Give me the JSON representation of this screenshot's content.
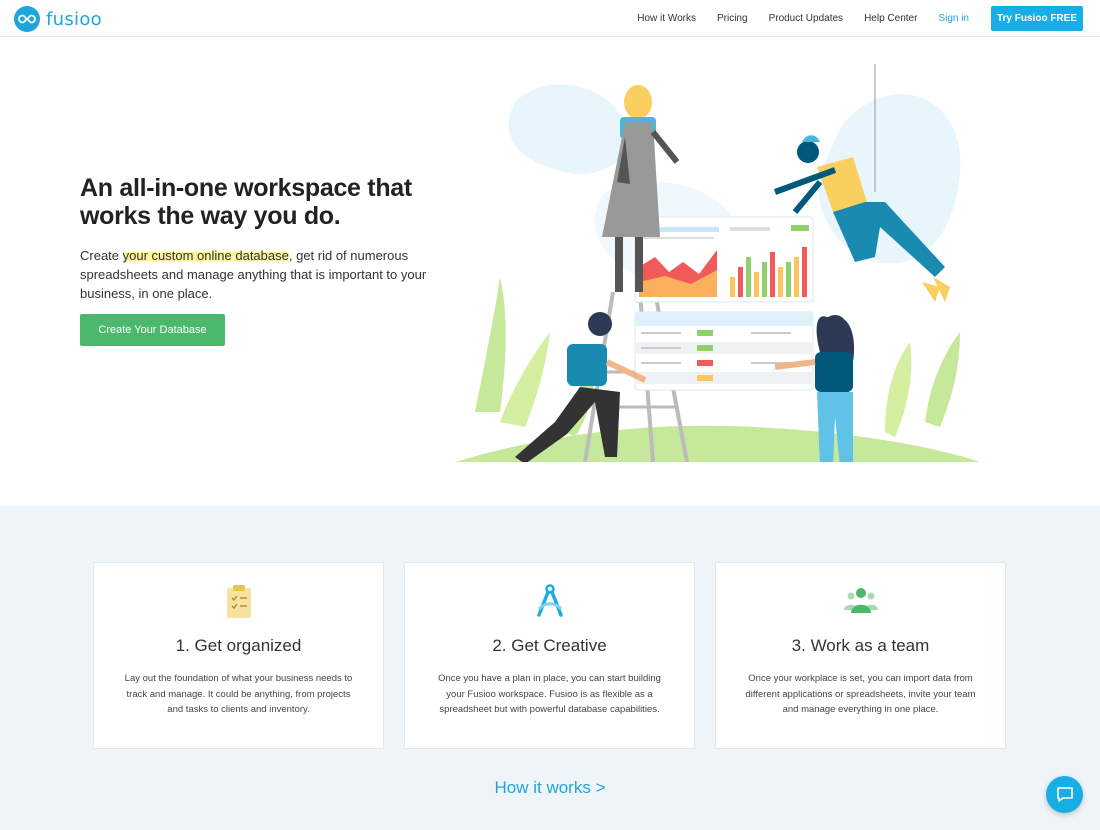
{
  "brand": {
    "name": "fusioo",
    "accent": "#1ea5dc",
    "green": "#4cb86c"
  },
  "nav": {
    "items": [
      {
        "label": "How it Works"
      },
      {
        "label": "Pricing"
      },
      {
        "label": "Product Updates"
      },
      {
        "label": "Help Center"
      }
    ],
    "signin_label": "Sign in",
    "try_label": "Try Fusioo FREE"
  },
  "hero": {
    "title": "An all-in-one workspace that works the way you do.",
    "lead_before": "Create ",
    "lead_highlight": "your custom online database",
    "lead_after": ", get rid of numerous spreadsheets and manage anything that is important to your business, in one place.",
    "cta_label": "Create Your Database"
  },
  "features": [
    {
      "icon": "clipboard-icon",
      "title": "1. Get organized",
      "text": "Lay out the foundation of what your business needs to track and manage. It could be anything, from projects and tasks to clients and inventory."
    },
    {
      "icon": "compass-icon",
      "title": "2. Get Creative",
      "text": "Once you have a plan in place, you can start building your Fusioo workspace. Fusioo is as flexible as a spreadsheet but with powerful database capabilities."
    },
    {
      "icon": "team-icon",
      "title": "3. Work as a team",
      "text": "Once your workplace is set, you can import data from different applications or spreadsheets, invite your team and manage everything in one place."
    }
  ],
  "how_link": "How it works >",
  "chat": {
    "icon": "chat-icon"
  }
}
